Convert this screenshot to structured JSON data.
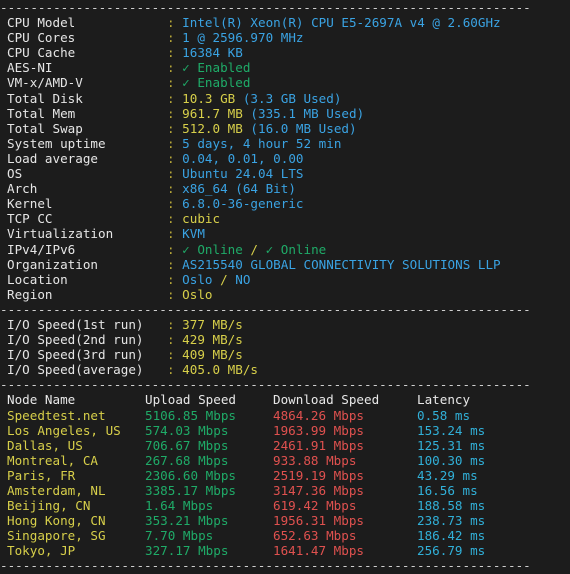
{
  "terminal": {
    "background": "#1c1c1c",
    "separator_text": "----------------------------------------------------------------------",
    "separator_top": "----------------------------------------------------------------------",
    "separator_mid1": "----------------------------------------------------------------------",
    "separator_mid2": "----------------------------------------------------------------------",
    "separator_bottom": "----------------------------------------------------------------------",
    "colon": ":",
    "colors": {
      "label": "#e6e6e6",
      "value_cyan": "#3aa3e3",
      "value_yellow": "#d7cf4a",
      "value_green": "#1fab68",
      "value_red": "#e0514f",
      "colon": "#b8a839",
      "separator": "#cfcfcf",
      "header": "#e8e8e8"
    }
  },
  "system_info": [
    {
      "label": "CPU Model",
      "value": "Intel(R) Xeon(R) CPU E5-2697A v4 @ 2.60GHz",
      "color": "cyan"
    },
    {
      "label": "CPU Cores",
      "value": "1 @ 2596.970 MHz",
      "color": "cyan"
    },
    {
      "label": "CPU Cache",
      "value": "16384 KB",
      "color": "cyan"
    },
    {
      "label": "AES-NI",
      "value": "Enabled",
      "color": "green",
      "check": "✓"
    },
    {
      "label": "VM-x/AMD-V",
      "value": "Enabled",
      "color": "green",
      "check": "✓"
    },
    {
      "label": "Total Disk",
      "value_main": "10.3 GB",
      "value_paren": "(3.3 GB Used)"
    },
    {
      "label": "Total Mem",
      "value_main": "961.7 MB",
      "value_paren": "(335.1 MB Used)"
    },
    {
      "label": "Total Swap",
      "value_main": "512.0 MB",
      "value_paren": "(16.0 MB Used)"
    },
    {
      "label": "System uptime",
      "value": "5 days, 4 hour 52 min",
      "color": "cyan"
    },
    {
      "label": "Load average",
      "value": "0.04, 0.01, 0.00",
      "color": "cyan"
    },
    {
      "label": "OS",
      "value": "Ubuntu 24.04 LTS",
      "color": "cyan"
    },
    {
      "label": "Arch",
      "value": "x86_64 (64 Bit)",
      "color": "cyan"
    },
    {
      "label": "Kernel",
      "value": "6.8.0-36-generic",
      "color": "cyan"
    },
    {
      "label": "TCP CC",
      "value": "cubic",
      "color": "yellow"
    },
    {
      "label": "Virtualization",
      "value": "KVM",
      "color": "cyan"
    },
    {
      "label": "IPv4/IPv6",
      "ipv4": "Online",
      "ipv6": "Online",
      "sep": "/",
      "check": "✓"
    },
    {
      "label": "Organization",
      "value": "AS215540 GLOBAL CONNECTIVITY SOLUTIONS LLP",
      "color": "cyan"
    },
    {
      "label": "Location",
      "city": "Oslo",
      "country": "NO",
      "sep": "/"
    },
    {
      "label": "Region",
      "value": "Oslo",
      "color": "yellow"
    }
  ],
  "io_speed": [
    {
      "label": "I/O Speed(1st run)",
      "value": "377 MB/s"
    },
    {
      "label": "I/O Speed(2nd run)",
      "value": "429 MB/s"
    },
    {
      "label": "I/O Speed(3rd run)",
      "value": "409 MB/s"
    },
    {
      "label": "I/O Speed(average)",
      "value": "405.0 MB/s"
    }
  ],
  "speedtest": {
    "headers": {
      "node": "Node Name",
      "upload": "Upload Speed",
      "download": "Download Speed",
      "latency": "Latency"
    },
    "rows": [
      {
        "node": "Speedtest.net",
        "upload": "5106.85 Mbps",
        "download": "4864.26 Mbps",
        "latency": "0.58 ms"
      },
      {
        "node": "Los Angeles, US",
        "upload": "574.03 Mbps",
        "download": "1963.99 Mbps",
        "latency": "153.24 ms"
      },
      {
        "node": "Dallas, US",
        "upload": "706.67 Mbps",
        "download": "2461.91 Mbps",
        "latency": "125.31 ms"
      },
      {
        "node": "Montreal, CA",
        "upload": "267.68 Mbps",
        "download": "933.88 Mbps",
        "latency": "100.30 ms"
      },
      {
        "node": "Paris, FR",
        "upload": "2306.60 Mbps",
        "download": "2519.19 Mbps",
        "latency": "43.29 ms"
      },
      {
        "node": "Amsterdam, NL",
        "upload": "3385.17 Mbps",
        "download": "3147.36 Mbps",
        "latency": "16.56 ms"
      },
      {
        "node": "Beijing, CN",
        "upload": "1.64 Mbps",
        "download": "619.42 Mbps",
        "latency": "188.58 ms"
      },
      {
        "node": "Hong Kong, CN",
        "upload": "353.21 Mbps",
        "download": "1956.31 Mbps",
        "latency": "238.73 ms"
      },
      {
        "node": "Singapore, SG",
        "upload": "7.70 Mbps",
        "download": "652.63 Mbps",
        "latency": "186.42 ms"
      },
      {
        "node": "Tokyo, JP",
        "upload": "327.17 Mbps",
        "download": "1641.47 Mbps",
        "latency": "256.79 ms"
      }
    ]
  }
}
